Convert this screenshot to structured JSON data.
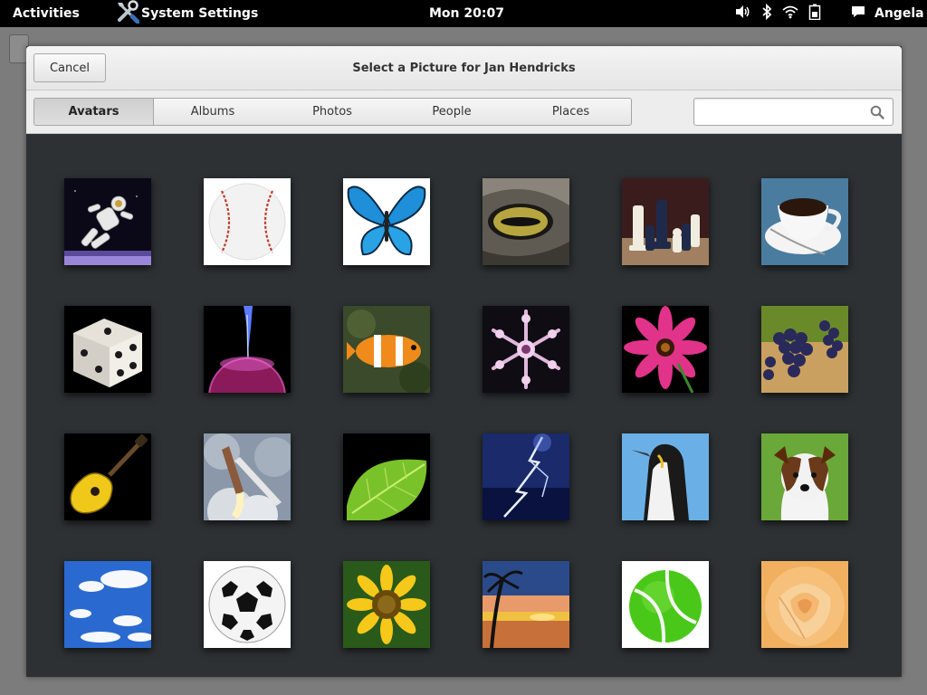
{
  "topbar": {
    "activities": "Activities",
    "app_name": "System Settings",
    "clock": "Mon 20:07",
    "user": "Angela",
    "tray_icons": [
      "volume-icon",
      "bluetooth-icon",
      "wifi-icon",
      "battery-icon",
      "chat-icon"
    ]
  },
  "dialog": {
    "cancel_label": "Cancel",
    "title": "Select a Picture for Jan Hendricks",
    "tabs": [
      {
        "label": "Avatars",
        "active": true
      },
      {
        "label": "Albums",
        "active": false
      },
      {
        "label": "Photos",
        "active": false
      },
      {
        "label": "People",
        "active": false
      },
      {
        "label": "Places",
        "active": false
      }
    ],
    "search": {
      "value": "",
      "placeholder": ""
    }
  },
  "pictures": [
    "astronaut",
    "baseball",
    "butterfly",
    "cat-eye",
    "chess",
    "coffee",
    "dice",
    "energy",
    "fish",
    "flake",
    "flower",
    "grapes",
    "guitar",
    "launch",
    "leaf",
    "lightning",
    "penguin",
    "puppy",
    "sky",
    "soccerball",
    "sunflower",
    "sunset",
    "tennis-ball",
    "yellow-rose"
  ],
  "colors": {
    "dialog_bg": "#2d3133",
    "topbar_bg": "#000000",
    "header_bg": "#efefef"
  }
}
